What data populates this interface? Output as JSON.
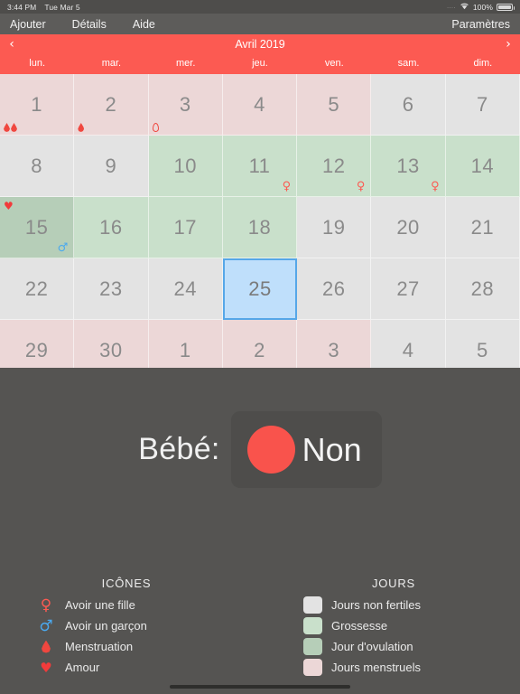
{
  "status_bar": {
    "time": "3:44 PM",
    "date": "Tue Mar 5",
    "dots": "....",
    "wifi_icon": "wifi-icon",
    "battery_percent": "100%",
    "battery_icon": "battery-full-icon"
  },
  "toolbar": {
    "add_label": "Ajouter",
    "details_label": "Détails",
    "help_label": "Aide",
    "settings_label": "Paramètres"
  },
  "month_nav": {
    "prev_icon": "chevron-left-icon",
    "next_icon": "chevron-right-icon",
    "prev_glyph": "‹",
    "next_glyph": "›",
    "title": "Avril 2019"
  },
  "weekdays": [
    "lun.",
    "mar.",
    "mer.",
    "jeu.",
    "ven.",
    "sam.",
    "dim."
  ],
  "calendar": {
    "cells": [
      {
        "day": "1",
        "type": "menstrual",
        "marks_bl": [
          "drop-filled",
          "drop-filled"
        ]
      },
      {
        "day": "2",
        "type": "menstrual",
        "marks_bl": [
          "drop-filled"
        ]
      },
      {
        "day": "3",
        "type": "menstrual",
        "marks_bl": [
          "drop-outline"
        ]
      },
      {
        "day": "4",
        "type": "menstrual"
      },
      {
        "day": "5",
        "type": "menstrual"
      },
      {
        "day": "6",
        "type": "infertile"
      },
      {
        "day": "7",
        "type": "infertile"
      },
      {
        "day": "8",
        "type": "infertile"
      },
      {
        "day": "9",
        "type": "infertile"
      },
      {
        "day": "10",
        "type": "pregnancy"
      },
      {
        "day": "11",
        "type": "pregnancy",
        "mark_br": "female"
      },
      {
        "day": "12",
        "type": "pregnancy",
        "mark_br": "female"
      },
      {
        "day": "13",
        "type": "pregnancy",
        "mark_br": "female"
      },
      {
        "day": "14",
        "type": "pregnancy"
      },
      {
        "day": "15",
        "type": "ovulation",
        "mark_tl": "heart",
        "mark_br": "male"
      },
      {
        "day": "16",
        "type": "pregnancy"
      },
      {
        "day": "17",
        "type": "pregnancy"
      },
      {
        "day": "18",
        "type": "pregnancy"
      },
      {
        "day": "19",
        "type": "infertile"
      },
      {
        "day": "20",
        "type": "infertile"
      },
      {
        "day": "21",
        "type": "infertile"
      },
      {
        "day": "22",
        "type": "infertile"
      },
      {
        "day": "23",
        "type": "infertile"
      },
      {
        "day": "24",
        "type": "infertile"
      },
      {
        "day": "25",
        "type": "selected"
      },
      {
        "day": "26",
        "type": "infertile"
      },
      {
        "day": "27",
        "type": "infertile"
      },
      {
        "day": "28",
        "type": "infertile"
      },
      {
        "day": "29",
        "type": "menstrual",
        "marks_bl": [
          "drop-filled",
          "drop-filled"
        ]
      },
      {
        "day": "30",
        "type": "menstrual",
        "marks_bl": [
          "drop-filled"
        ]
      },
      {
        "day": "1",
        "type": "menstrual",
        "marks_bl": [
          "drop-outline"
        ]
      },
      {
        "day": "2",
        "type": "menstrual"
      },
      {
        "day": "3",
        "type": "menstrual"
      },
      {
        "day": "4",
        "type": "infertile"
      },
      {
        "day": "5",
        "type": "infertile"
      }
    ]
  },
  "baby": {
    "label": "Bébé:",
    "value": "Non",
    "dot_icon": "red-circle-icon"
  },
  "legend_icons": {
    "title": "ICÔNES",
    "items": [
      {
        "icon": "female-symbol-icon",
        "label": "Avoir une fille"
      },
      {
        "icon": "male-symbol-icon",
        "label": "Avoir un garçon"
      },
      {
        "icon": "blood-drop-icon",
        "label": "Menstruation"
      },
      {
        "icon": "heart-icon",
        "label": "Amour"
      }
    ]
  },
  "legend_days": {
    "title": "JOURS",
    "items": [
      {
        "swatch": "#e3e3e3",
        "label": "Jours non fertiles"
      },
      {
        "swatch": "#c9e0cb",
        "label": "Grossesse"
      },
      {
        "swatch": "#b6ceb8",
        "label": "Jour d'ovulation"
      },
      {
        "swatch": "#ecd7d7",
        "label": "Jours menstruels"
      }
    ]
  },
  "colors": {
    "accent_red": "#fc5a52",
    "panel_bg": "#555452",
    "toolbar_bg": "#5d5c5a",
    "selected_blue": "#bfdffb",
    "selected_border": "#56a7e8",
    "male_blue": "#4aa9ef",
    "heart_red": "#f23b3b"
  }
}
